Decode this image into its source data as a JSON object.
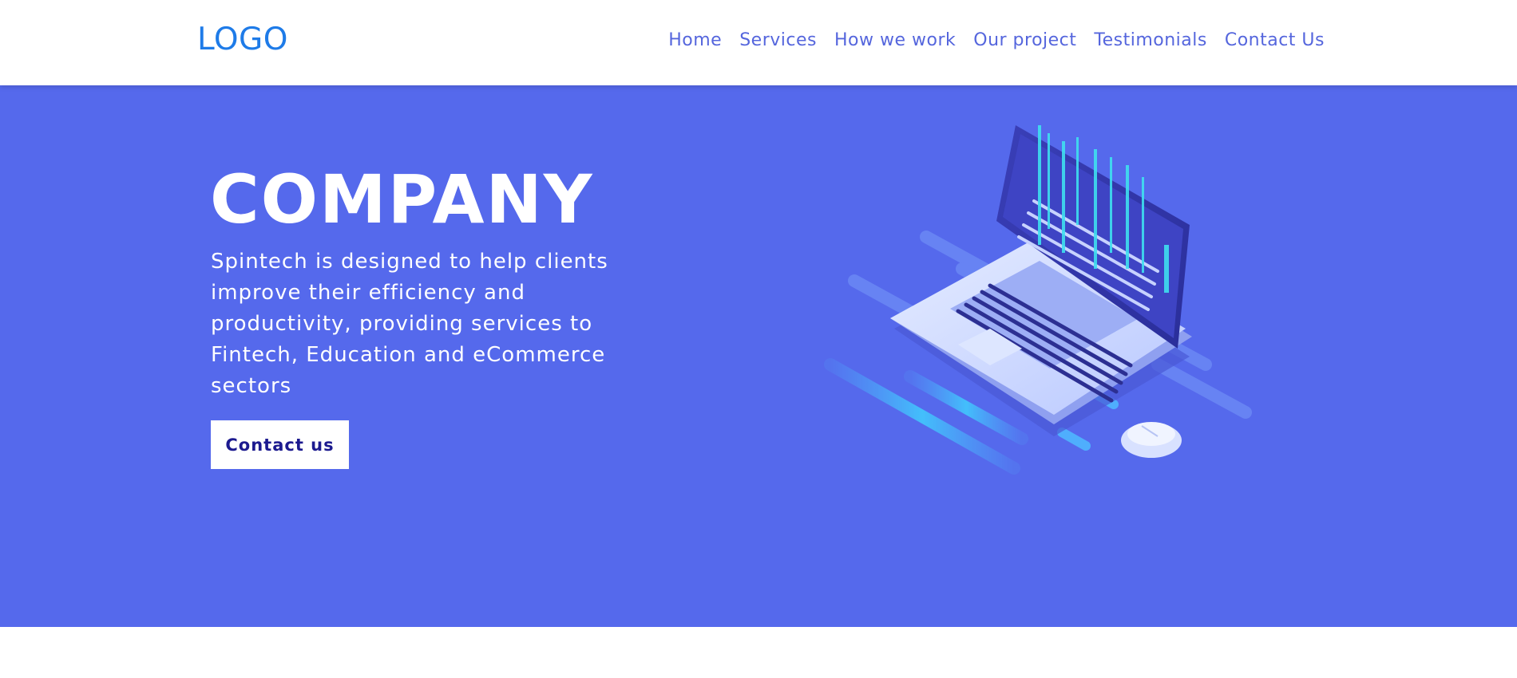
{
  "header": {
    "logo": "LOGO",
    "nav": [
      {
        "label": "Home"
      },
      {
        "label": "Services"
      },
      {
        "label": "How we work"
      },
      {
        "label": "Our project"
      },
      {
        "label": "Testimonials"
      },
      {
        "label": "Contact Us"
      }
    ]
  },
  "hero": {
    "title": "COMPANY",
    "description": "Spintech is designed to help clients improve their efficiency and productivity, providing services to Fintech, Education and eCommerce sectors",
    "cta_label": "Contact us",
    "illustration": "laptop-illustration"
  },
  "colors": {
    "hero_bg": "#5569EC",
    "logo": "#1E7BE8",
    "nav_text": "#5566DD",
    "cta_text": "#1C1A8F"
  }
}
